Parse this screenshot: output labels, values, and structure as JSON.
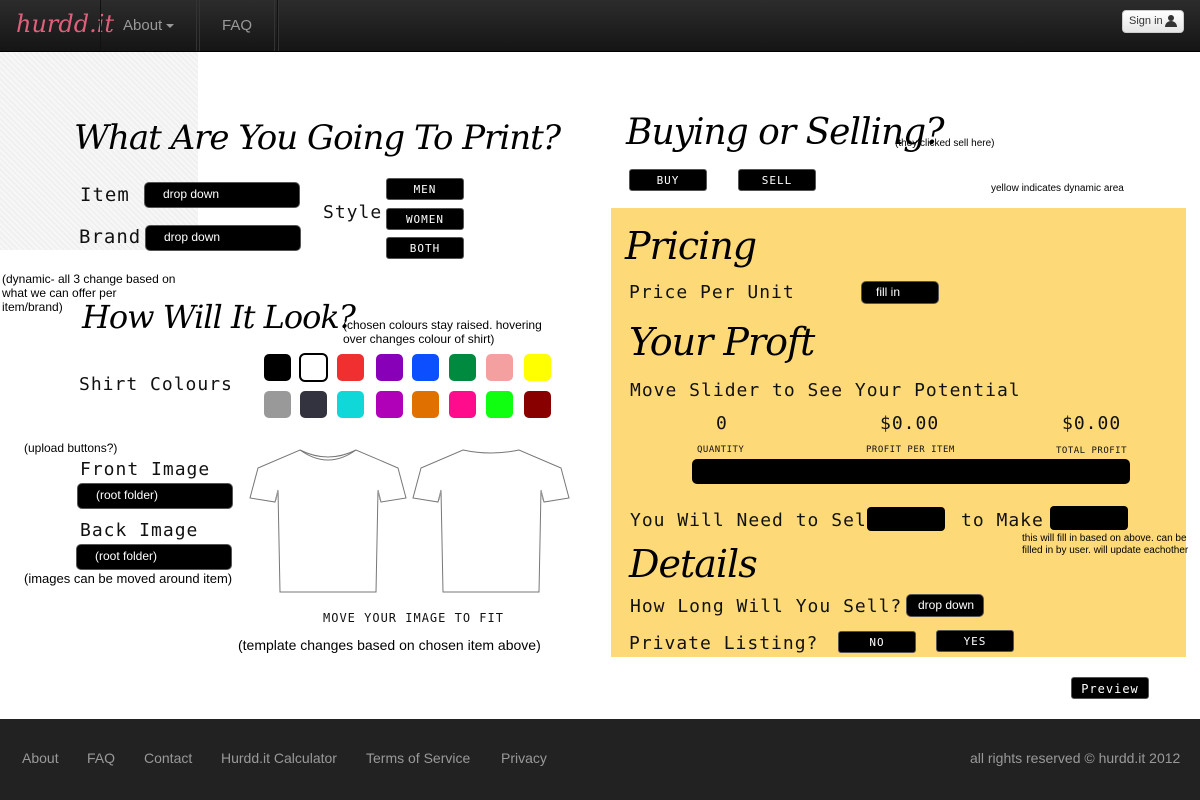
{
  "nav": {
    "logo": "hurdd.it",
    "about": "About",
    "faq": "FAQ",
    "signin": "Sign in"
  },
  "print_section": {
    "heading": "What Are You Going To Print?",
    "item_label": "Item",
    "item_value": "drop down",
    "brand_label": "Brand",
    "brand_value": "drop down",
    "style_label": "Style",
    "style_options": [
      "MEN",
      "WOMEN",
      "BOTH"
    ],
    "dynamic_note": "(dynamic- all 3 change based on what we can offer per item/brand)"
  },
  "look_section": {
    "heading": "How Will It Look?",
    "colour_note": "(chosen colours stay raised. hovering over changes colour of shirt)",
    "shirt_colours_label": "Shirt Colours",
    "colours_row1": [
      "#000000",
      "#ffffff",
      "#f03030",
      "#8800b8",
      "#0b4fff",
      "#008a40",
      "#f5a0a0",
      "#ffff00"
    ],
    "colours_row2": [
      "#999999",
      "#333340",
      "#10d8d8",
      "#b000b8",
      "#e07000",
      "#ff0c8c",
      "#10ff10",
      "#880000"
    ],
    "upload_note": "(upload buttons?)",
    "front_label": "Front Image",
    "front_value": "(root folder)",
    "back_label": "Back Image",
    "back_value": "(root folder)",
    "move_note": "(images can be moved around item)",
    "move_fit": "MOVE YOUR IMAGE TO FIT",
    "template_note": "(template changes based on chosen item above)"
  },
  "buy_sell": {
    "heading": "Buying or Selling?",
    "clicked_note": "(they clicked sell here)",
    "buy": "BUY",
    "sell": "SELL",
    "yellow_note": "yellow indicates dynamic area"
  },
  "pricing": {
    "heading": "Pricing",
    "price_label": "Price Per Unit",
    "price_value": "fill in",
    "profit_heading": "Your Proft",
    "slider_label": "Move Slider to See Your Potential",
    "quantity_value": "0",
    "quantity_label": "QUANTITY",
    "per_item_value": "$0.00",
    "per_item_label": "PROFIT PER ITEM",
    "total_value": "$0.00",
    "total_label": "TOTAL PROFIT",
    "need_label": "You Will Need to Sell",
    "make_label": "to Make",
    "fill_note": "this will fill in based on above. can be filled in by user. will update eachother"
  },
  "details": {
    "heading": "Details",
    "how_long_label": "How Long Will You Sell?",
    "how_long_value": "drop down",
    "private_label": "Private Listing?",
    "no": "NO",
    "yes": "YES",
    "preview": "Preview"
  },
  "footer": {
    "links": [
      "About",
      "FAQ",
      "Contact",
      "Hurdd.it Calculator",
      "Terms of Service",
      "Privacy"
    ],
    "copyright": "all rights reserved © hurdd.it 2012"
  }
}
